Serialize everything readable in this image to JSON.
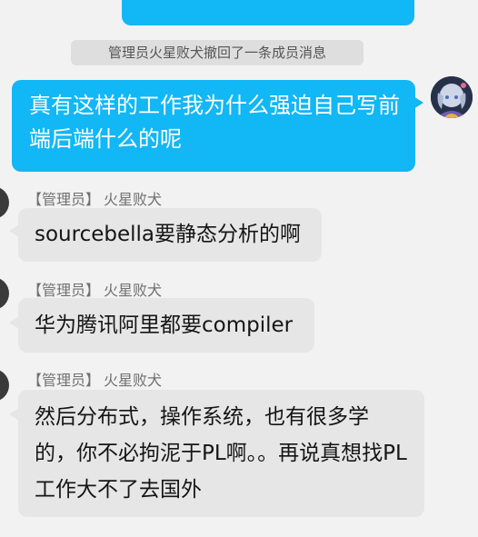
{
  "colors": {
    "background": "#f2f2f2",
    "self_bubble": "#12b7f5",
    "peer_bubble": "#e6e6e6",
    "system_notice": "#dedede"
  },
  "system_notice": "管理员火星败犬撤回了一条成员消息",
  "self_message": {
    "text": "真有这样的工作我为什么强迫自己写前端后端什么的呢"
  },
  "messages": [
    {
      "sender_role": "【管理员】",
      "sender_name": "火星败犬",
      "text": "sourcebella要静态分析的啊"
    },
    {
      "sender_role": "【管理员】",
      "sender_name": "火星败犬",
      "text": "华为腾讯阿里都要compiler"
    },
    {
      "sender_role": "【管理员】",
      "sender_name": "火星败犬",
      "text": "然后分布式，操作系统，也有很多学的，你不必拘泥于PL啊。。再说真想找PL工作大不了去国外"
    }
  ]
}
